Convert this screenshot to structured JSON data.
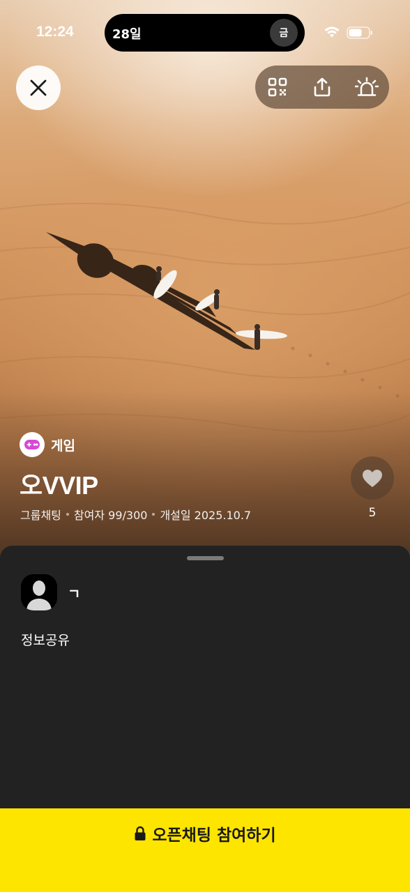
{
  "status_bar": {
    "time": "12:24",
    "date_text": "28일",
    "day_label": "금"
  },
  "top_bar": {
    "close_icon": "close-icon",
    "actions": [
      "qr-code-icon",
      "share-icon",
      "report-siren-icon"
    ]
  },
  "room": {
    "category_icon": "game-controller-icon",
    "category": "게임",
    "title": "오VVIP",
    "type": "그룹채팅",
    "participants": "참여자 99/300",
    "created": "개설일 2025.10.7",
    "like_icon": "heart-icon",
    "likes": "5"
  },
  "sheet": {
    "host_name": "ㄱ",
    "description": "정보공유"
  },
  "join_button": {
    "icon": "lock-icon",
    "label": "오픈채팅 참여하기",
    "color": "#fee500"
  }
}
